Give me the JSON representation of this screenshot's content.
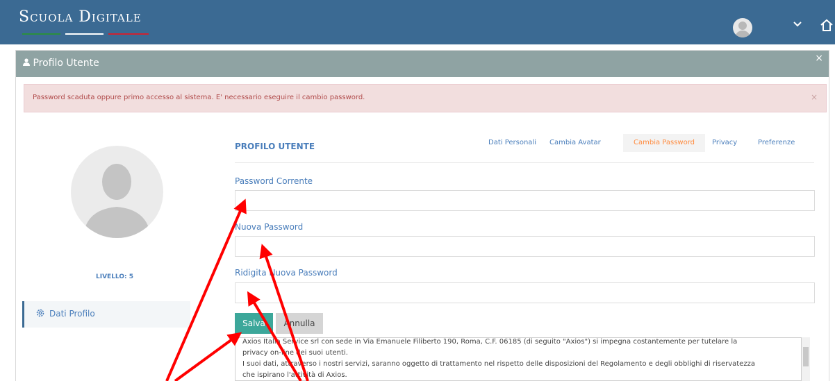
{
  "app": {
    "logo_text": "Scuola Digitale",
    "logo_colors": [
      "#2a8f3e",
      "#ffffff",
      "#cf2230"
    ],
    "topbar_color": "#3b6a93",
    "home_icon": "home-icon",
    "chevron_icon": "chevron-down-icon"
  },
  "modal": {
    "title": "Profilo Utente",
    "close": "×"
  },
  "alert": {
    "text": "Password scaduta oppure primo accesso al sistema. E' necessario eseguire il cambio password.",
    "close": "×"
  },
  "profile": {
    "livello": "LIVELLO: 5",
    "side_menu_item": "Dati Profilo"
  },
  "section": {
    "title": "PROFILO UTENTE",
    "tabs": [
      {
        "label": "Dati Personali",
        "active": false
      },
      {
        "label": "Cambia Avatar",
        "active": false
      },
      {
        "label": "Cambia Password",
        "active": true
      },
      {
        "label": "Privacy",
        "active": false
      },
      {
        "label": "Preferenze",
        "active": false
      }
    ]
  },
  "form": {
    "current_password_label": "Password Corrente",
    "new_password_label": "Nuova Password",
    "confirm_password_label": "Ridigita Nuova Password",
    "current_password_value": "",
    "new_password_value": "",
    "confirm_password_value": "",
    "save_label": "Salva",
    "cancel_label": "Annulla"
  },
  "privacy": {
    "lines": [
      "Axios Italia Service srl con sede in Via Emanuele Filiberto 190, Roma, C.F. 06185 (di seguito \"Axios\") si impegna costantemente per tutelare la",
      "privacy on-line dei suoi utenti.",
      "I suoi dati, attraverso i nostri servizi, saranno oggetto di trattamento nel rispetto delle disposizioni del Regolamento e degli obblighi di riservatezza",
      "che ispirano l'attività di Axios."
    ]
  },
  "colors": {
    "accent": "#4a7ebb",
    "active_tab": "#ff8a3d",
    "save_button": "#3ca79a",
    "alert_bg": "#f2dede",
    "annotation_arrow": "#ff0000"
  }
}
